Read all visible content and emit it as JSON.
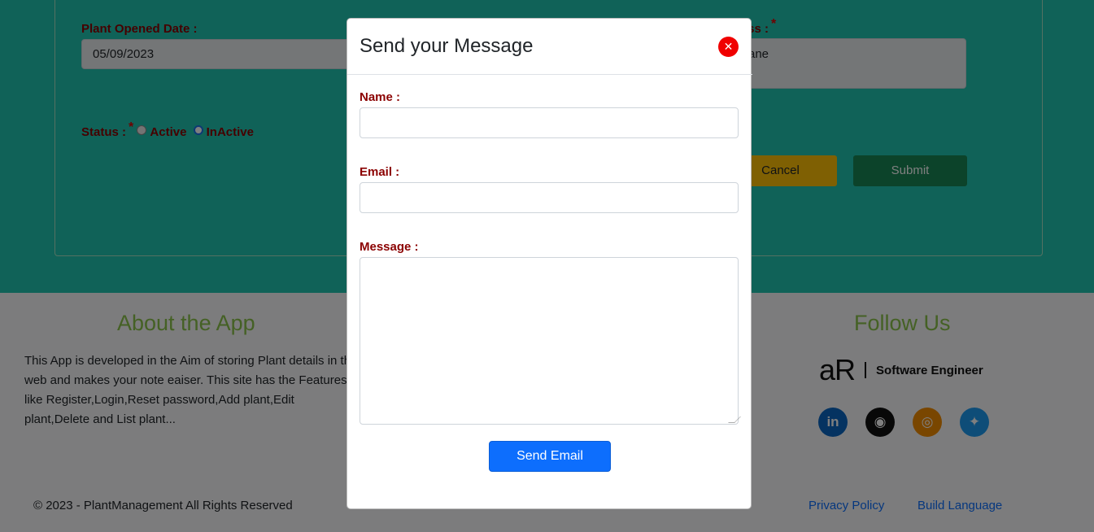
{
  "form": {
    "plant_opened_date_label": "Plant Opened Date :",
    "plant_opened_date_value": "05/09/2023",
    "address_label": "ress :",
    "address_value": "ane",
    "status_label": "Status :",
    "status_options": [
      "Active",
      "InActive"
    ],
    "status_selected": "InActive",
    "required_marker": "*",
    "cancel_label": "Cancel",
    "submit_label": "Submit"
  },
  "footer": {
    "about_title": "About the App",
    "about_text": "This App is developed in the Aim of storing Plant details in the web and makes your note eaiser. This site has the Features like Register,Login,Reset password,Add plant,Edit plant,Delete and List plant...",
    "follow_title": "Follow Us",
    "brand_logo": "aR",
    "brand_tagline": "Software Engineer",
    "socials": [
      {
        "name": "linkedin-icon",
        "glyph": "in",
        "color": "#0a66c2"
      },
      {
        "name": "github-icon",
        "glyph": "◉",
        "color": "#111111"
      },
      {
        "name": "instagram-icon",
        "glyph": "◎",
        "color": "#f28c00"
      },
      {
        "name": "twitter-icon",
        "glyph": "✦",
        "color": "#1d9bf0"
      }
    ],
    "copyright": "© 2023 - PlantManagement All Rights Reserved",
    "privacy_link": "Privacy Policy",
    "build_link": "Build Language"
  },
  "modal": {
    "title": "Send your Message",
    "close_glyph": "✕",
    "name_label": "Name :",
    "name_value": "",
    "email_label": "Email :",
    "email_value": "",
    "message_label": "Message :",
    "message_value": "",
    "send_label": "Send Email"
  },
  "colors": {
    "hero_bg": "#20c5b1",
    "label_color": "#8b0000",
    "accent_green": "#8bc34a",
    "primary_blue": "#0d6efd",
    "close_red": "#f00000"
  }
}
